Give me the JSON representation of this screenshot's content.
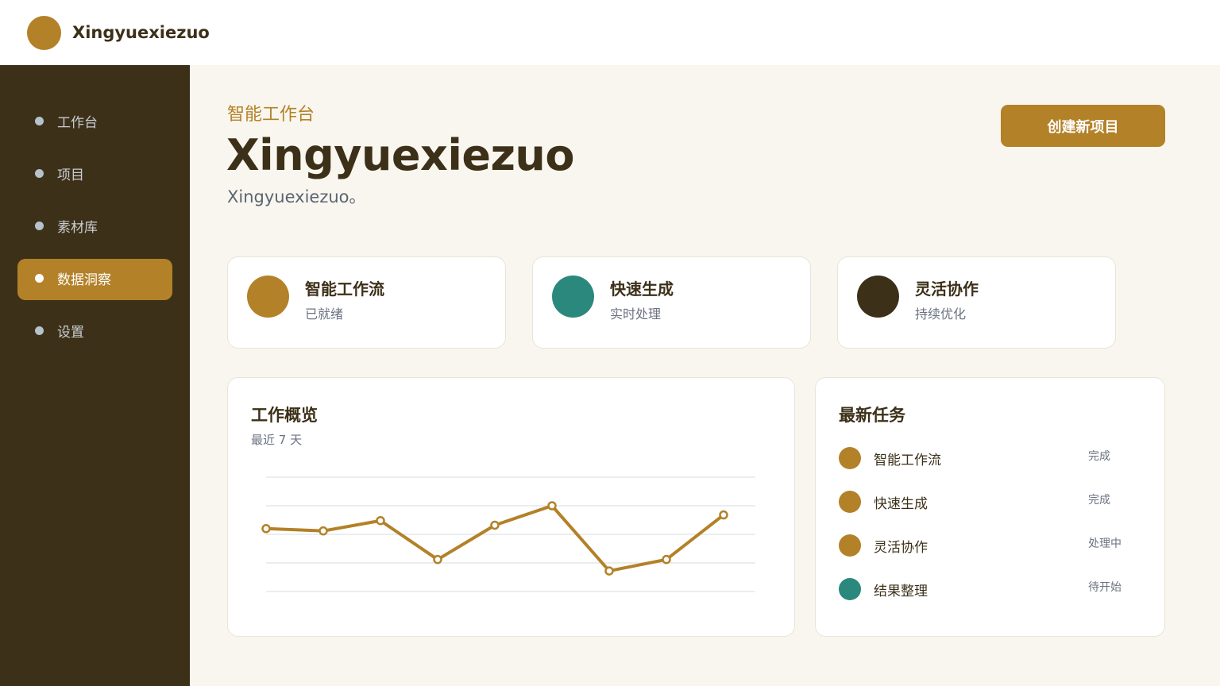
{
  "app": {
    "brand": "Xingyuexiezuo"
  },
  "colors": {
    "accent": "#b38128",
    "teal": "#2a887c",
    "dark": "#3d3019"
  },
  "sidebar": {
    "items": [
      {
        "label": "工作台",
        "active": false
      },
      {
        "label": "项目",
        "active": false
      },
      {
        "label": "素材库",
        "active": false
      },
      {
        "label": "数据洞察",
        "active": true
      },
      {
        "label": "设置",
        "active": false
      }
    ]
  },
  "header": {
    "eyebrow": "智能工作台",
    "title": "Xingyuexiezuo",
    "subtitle": "Xingyuexiezuo。",
    "create_label": "创建新项目"
  },
  "cards": [
    {
      "title": "智能工作流",
      "sub": "已就绪",
      "color": "#b38128"
    },
    {
      "title": "快速生成",
      "sub": "实时处理",
      "color": "#2a887c"
    },
    {
      "title": "灵活协作",
      "sub": "持续优化",
      "color": "#3d3019"
    }
  ],
  "overview": {
    "title": "工作概览",
    "sub": "最近 7 天"
  },
  "chart_data": {
    "type": "line",
    "series": [
      {
        "values": [
          55,
          53,
          62,
          28,
          58,
          75,
          18,
          28,
          67
        ]
      }
    ],
    "ylim": [
      0,
      100
    ],
    "grid": true,
    "color": "#b38128"
  },
  "tasks": {
    "title": "最新任务",
    "items": [
      {
        "name": "智能工作流",
        "status": "完成",
        "color": "#b38128"
      },
      {
        "name": "快速生成",
        "status": "完成",
        "color": "#b38128"
      },
      {
        "name": "灵活协作",
        "status": "处理中",
        "color": "#b38128"
      },
      {
        "name": "结果整理",
        "status": "待开始",
        "color": "#2a887c"
      }
    ]
  }
}
